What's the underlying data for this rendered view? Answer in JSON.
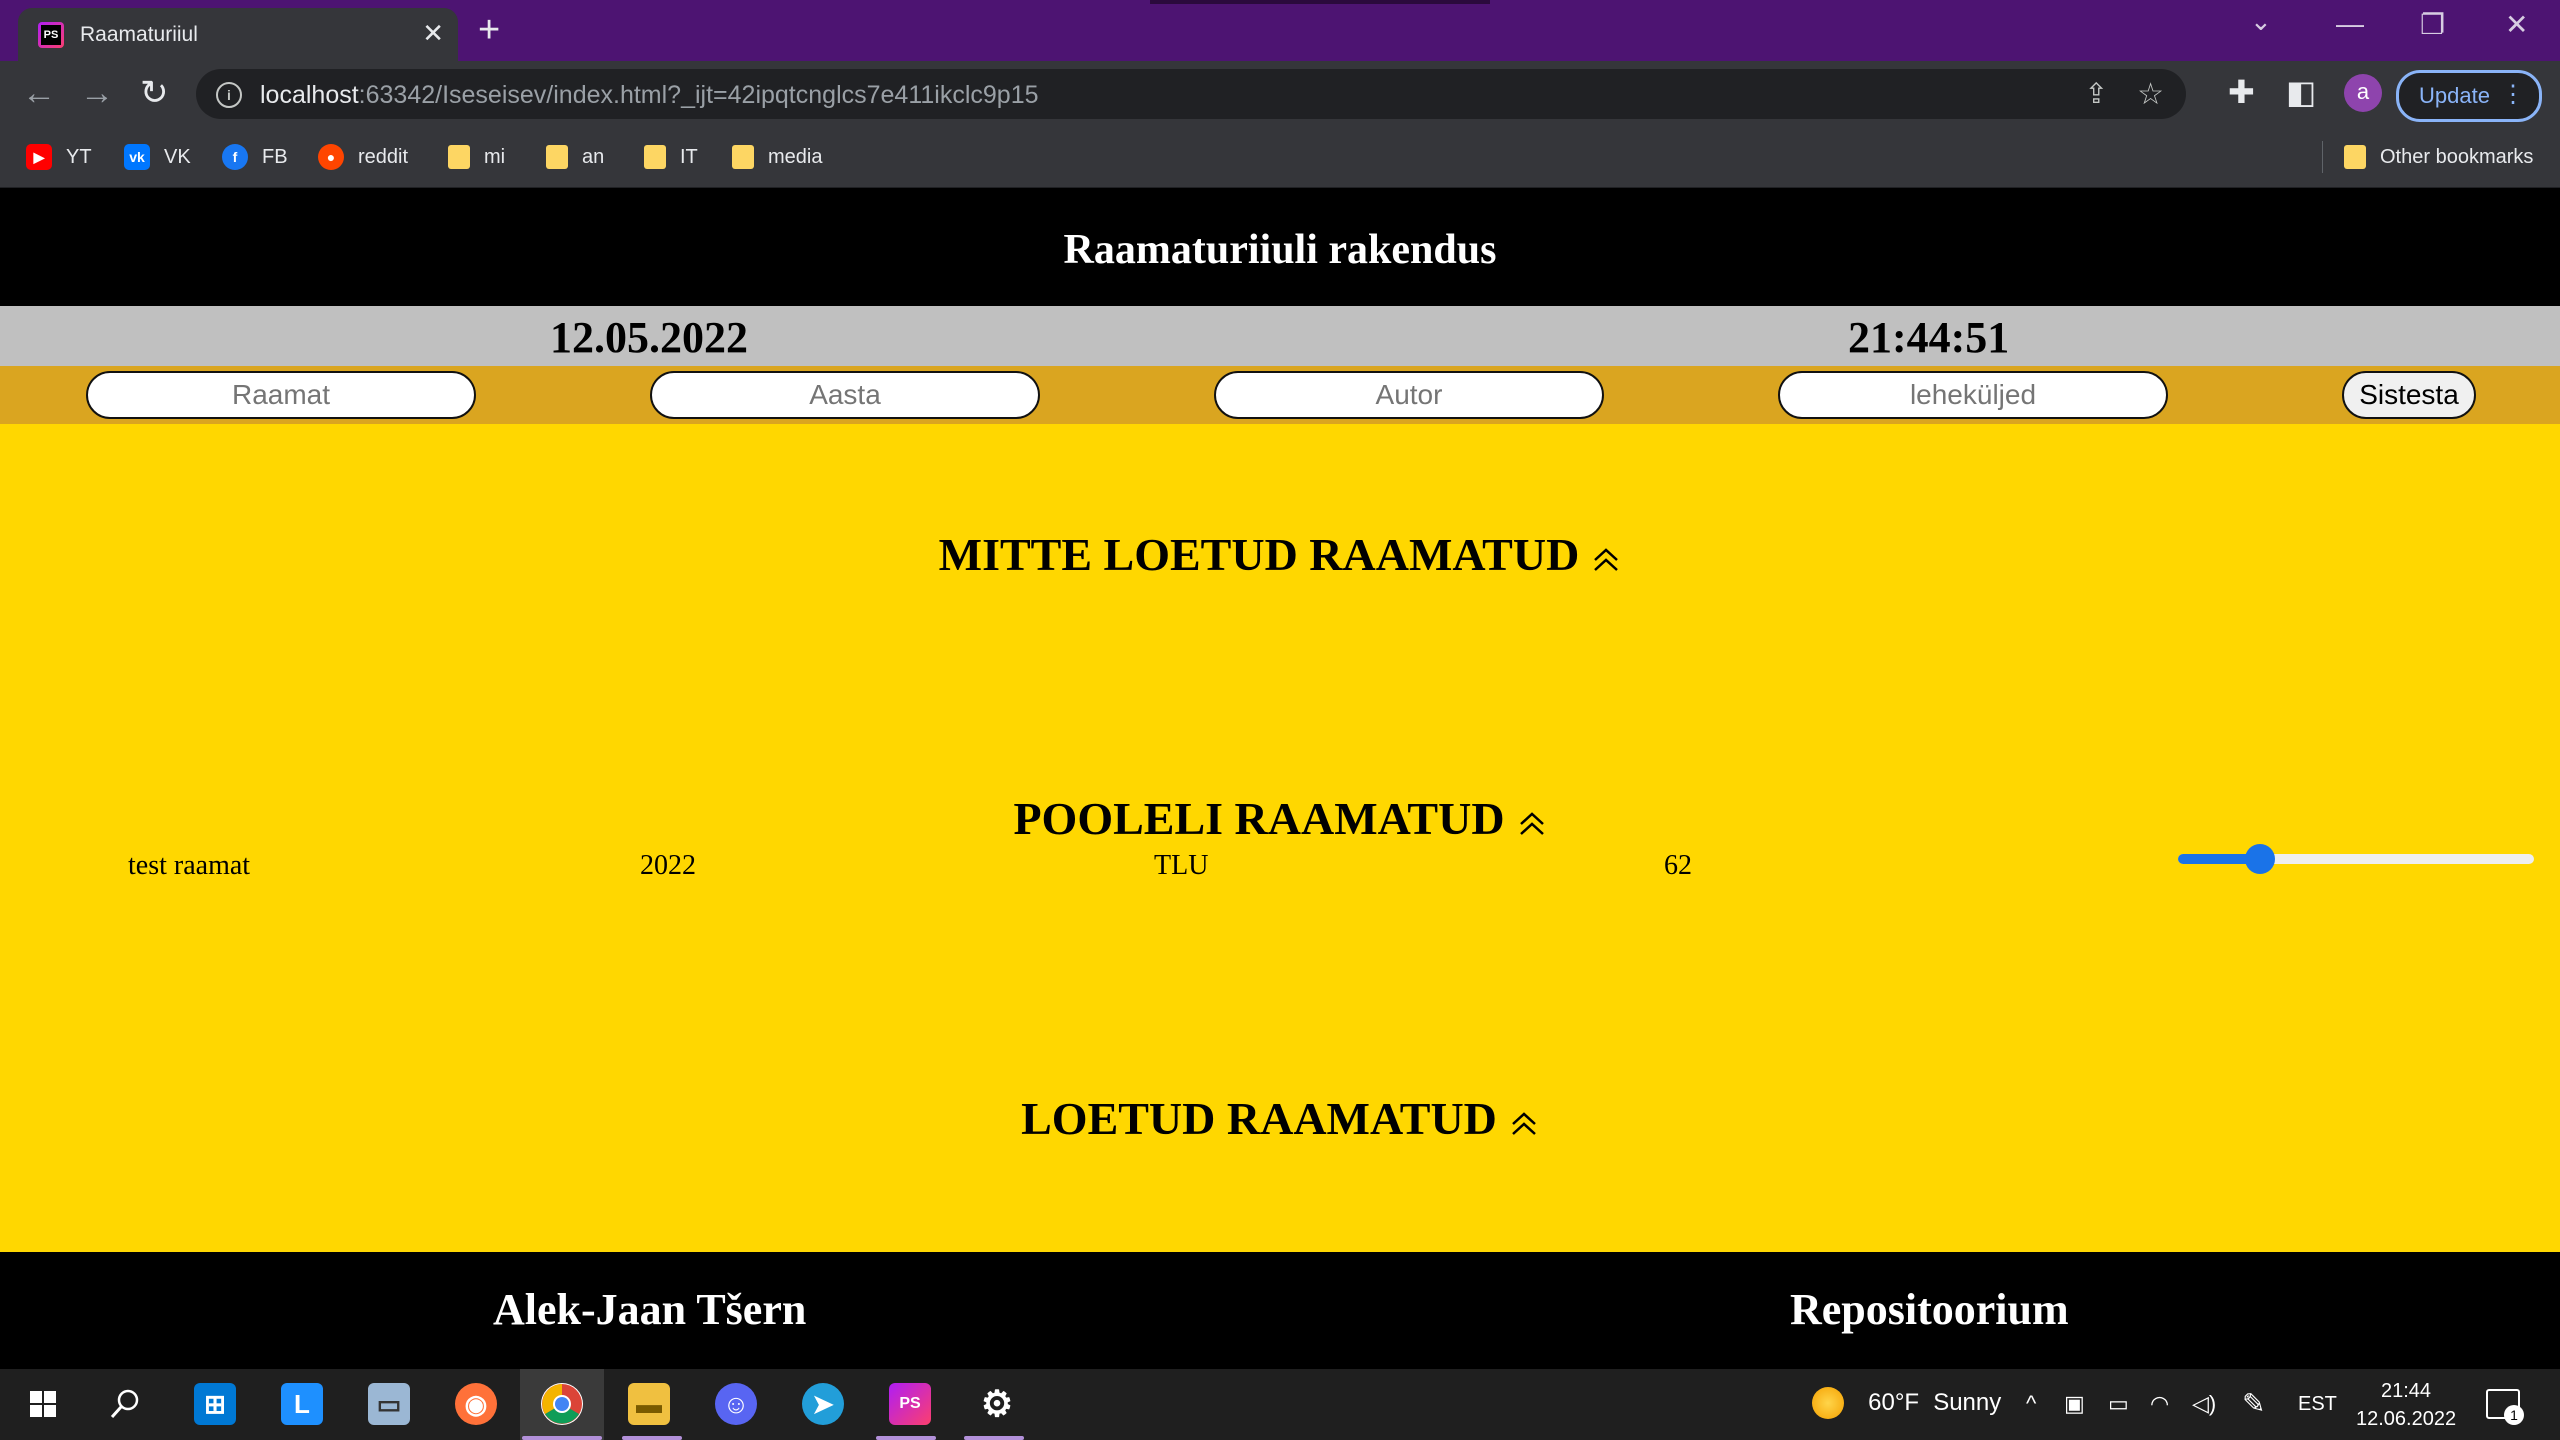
{
  "browser": {
    "tab_title": "Raamaturiiul",
    "tab_favicon_text": "PS",
    "url_host": "localhost",
    "url_rest": ":63342/Iseseisev/index.html?_ijt=42ipqtcnglcs7e411ikclc9p15",
    "avatar_letter": "a",
    "update_label": "Update",
    "bookmarks": [
      {
        "label": "YT",
        "icon": "youtube-icon",
        "color": "#ff0000"
      },
      {
        "label": "VK",
        "icon": "vk-icon",
        "color": "#0077ff"
      },
      {
        "label": "FB",
        "icon": "facebook-icon",
        "color": "#1877f2"
      },
      {
        "label": "reddit",
        "icon": "reddit-icon",
        "color": "#ff4500"
      },
      {
        "label": "mi",
        "icon": "folder-icon",
        "color": "#fdd663"
      },
      {
        "label": "an",
        "icon": "folder-icon",
        "color": "#fdd663"
      },
      {
        "label": "IT",
        "icon": "folder-icon",
        "color": "#fdd663"
      },
      {
        "label": "media",
        "icon": "folder-icon",
        "color": "#fdd663"
      }
    ],
    "other_bookmarks": "Other bookmarks"
  },
  "app": {
    "title": "Raamaturiiuli rakendus",
    "date": "12.05.2022",
    "time": "21:44:51",
    "form": {
      "book_placeholder": "Raamat",
      "year_placeholder": "Aasta",
      "author_placeholder": "Autor",
      "pages_placeholder": "leheküljed",
      "submit_label": "Sistesta"
    },
    "sections": {
      "unread": "MITTE LOETUD RAAMATUD",
      "in_progress": "POOLELI RAAMATUD",
      "read": "LOETUD RAAMATUD"
    },
    "in_progress_books": [
      {
        "title": "test raamat",
        "year": "2022",
        "author": "TLU",
        "pages": "62",
        "progress": 0.23
      }
    ],
    "footer": {
      "author": "Alek-Jaan Tšern",
      "repo": "Repositoorium"
    },
    "colors": {
      "header": "#000000",
      "date_bar": "#c0c0c0",
      "form_bar": "#daa520",
      "main": "#ffd700"
    }
  },
  "taskbar": {
    "weather_temp": "60°F",
    "weather_text": "Sunny",
    "language": "EST",
    "clock_time": "21:44",
    "clock_date": "12.06.2022",
    "notification_count": "1"
  }
}
